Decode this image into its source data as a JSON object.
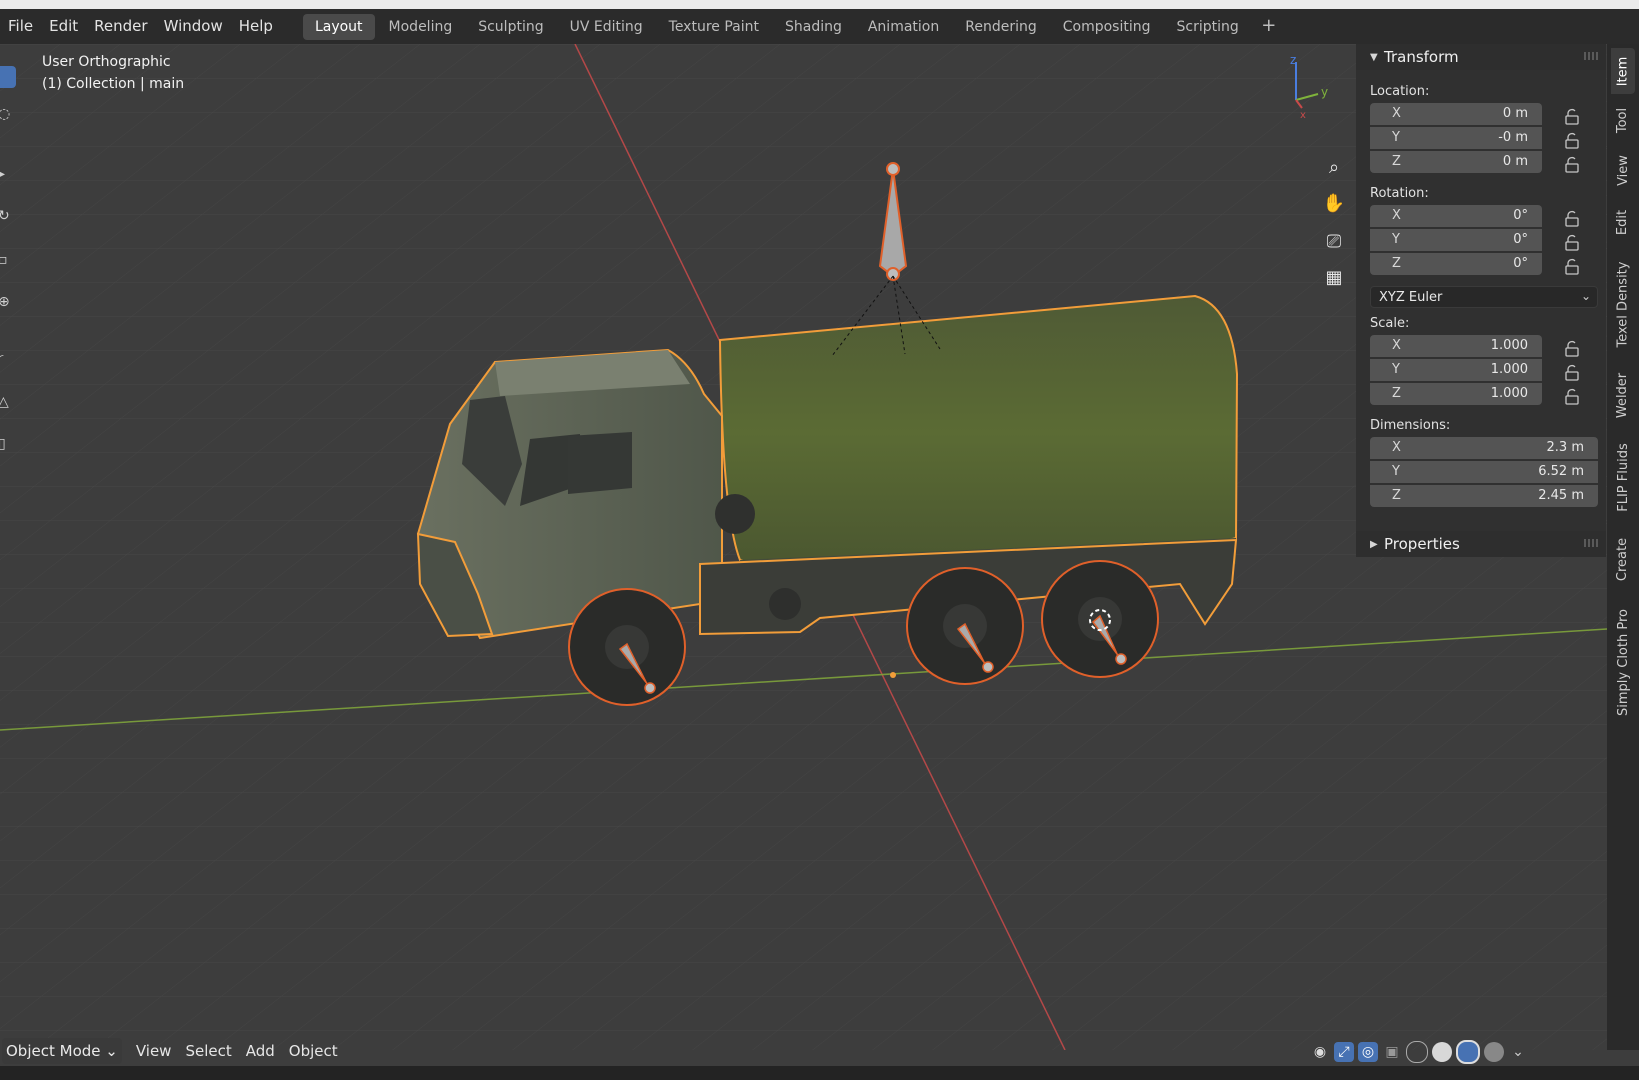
{
  "menus": [
    "File",
    "Edit",
    "Render",
    "Window",
    "Help"
  ],
  "workspaces": [
    "Layout",
    "Modeling",
    "Sculpting",
    "UV Editing",
    "Texture Paint",
    "Shading",
    "Animation",
    "Rendering",
    "Compositing",
    "Scripting"
  ],
  "workspace_add": "+",
  "viewport": {
    "view_name": "User Orthographic",
    "collection_info": "(1) Collection | main",
    "axis_labels": {
      "x": "x",
      "y": "y",
      "z": "z"
    }
  },
  "transform": {
    "title": "Transform",
    "location_label": "Location:",
    "location": [
      {
        "axis": "X",
        "value": "0 m"
      },
      {
        "axis": "Y",
        "value": "-0 m"
      },
      {
        "axis": "Z",
        "value": "0 m"
      }
    ],
    "rotation_label": "Rotation:",
    "rotation": [
      {
        "axis": "X",
        "value": "0°"
      },
      {
        "axis": "Y",
        "value": "0°"
      },
      {
        "axis": "Z",
        "value": "0°"
      }
    ],
    "rotation_mode": "XYZ Euler",
    "scale_label": "Scale:",
    "scale": [
      {
        "axis": "X",
        "value": "1.000"
      },
      {
        "axis": "Y",
        "value": "1.000"
      },
      {
        "axis": "Z",
        "value": "1.000"
      }
    ],
    "dimensions_label": "Dimensions:",
    "dimensions": [
      {
        "axis": "X",
        "value": "2.3 m"
      },
      {
        "axis": "Y",
        "value": "6.52 m"
      },
      {
        "axis": "Z",
        "value": "2.45 m"
      }
    ]
  },
  "properties_title": "Properties",
  "side_tabs": [
    "Item",
    "Tool",
    "View",
    "Edit",
    "Texel Density",
    "Welder",
    "FLIP Fluids",
    "Create",
    "Simply Cloth Pro"
  ],
  "bottom": {
    "mode": "Object Mode",
    "menus": [
      "View",
      "Select",
      "Add",
      "Object"
    ]
  },
  "colors": {
    "accent": "#4772b3",
    "selection": "#f29d3a",
    "x_axis": "#c84a4a",
    "y_axis": "#7fa33b",
    "tarp": "#5a6a34",
    "cab": "#5c6350"
  }
}
